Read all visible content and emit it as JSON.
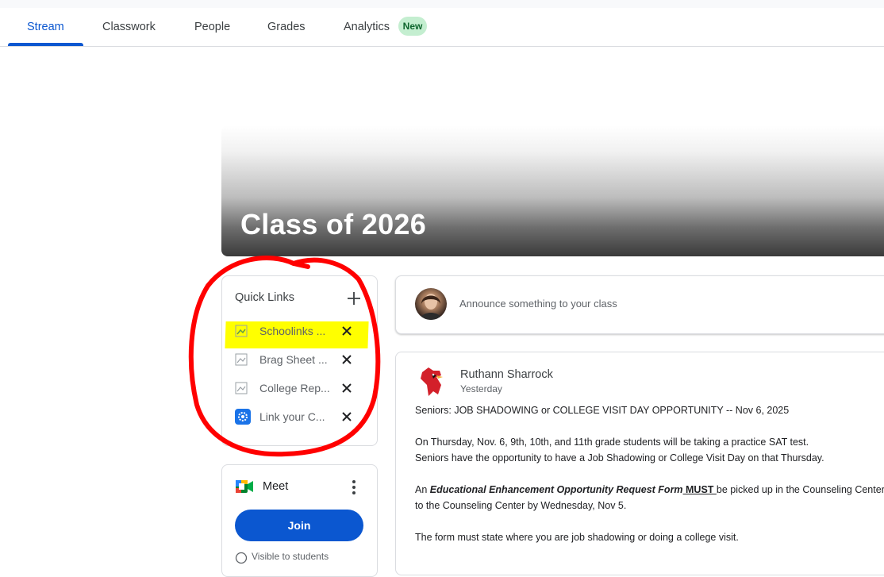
{
  "tabs": [
    {
      "label": "Stream"
    },
    {
      "label": "Classwork"
    },
    {
      "label": "People"
    },
    {
      "label": "Grades"
    },
    {
      "label": "Analytics"
    }
  ],
  "analytics_badge": "New",
  "banner": {
    "title": "Class of 2026"
  },
  "quick_links": {
    "title": "Quick Links",
    "items": [
      {
        "label": "Schoolinks ...",
        "highlighted": true
      },
      {
        "label": "Brag Sheet ...",
        "highlighted": false
      },
      {
        "label": "College Rep...",
        "highlighted": false
      },
      {
        "label": "Link your C...",
        "highlighted": false
      }
    ]
  },
  "meet": {
    "label": "Meet",
    "join_label": "Join",
    "visible_text": "Visible to students"
  },
  "announce": {
    "placeholder": "Announce something to your class"
  },
  "post": {
    "author": "Ruthann Sharrock",
    "time": "Yesterday",
    "line1": "Seniors:  JOB SHADOWING or COLLEGE VISIT DAY OPPORTUNITY -- Nov 6, 2025",
    "line2": "On Thursday, Nov. 6, 9th, 10th, and 11th grade students will be taking a practice SAT test.",
    "line3": "Seniors have the opportunity to have a Job Shadowing  or College Visit Day on that Thursday.",
    "line4_prefix": "An ",
    "line4_form": "Educational Enhancement Opportunity Request Form",
    "line4_must": " MUST ",
    "line4_suffix": "be picked up in the Counseling Center,",
    "line5": "to the Counseling Center by Wednesday, Nov 5.",
    "line6": "The form must state where you are job shadowing or doing a college visit."
  },
  "colors": {
    "accent": "#0b57d0",
    "highlight": "#ffff00",
    "annotation": "#ff0000"
  }
}
